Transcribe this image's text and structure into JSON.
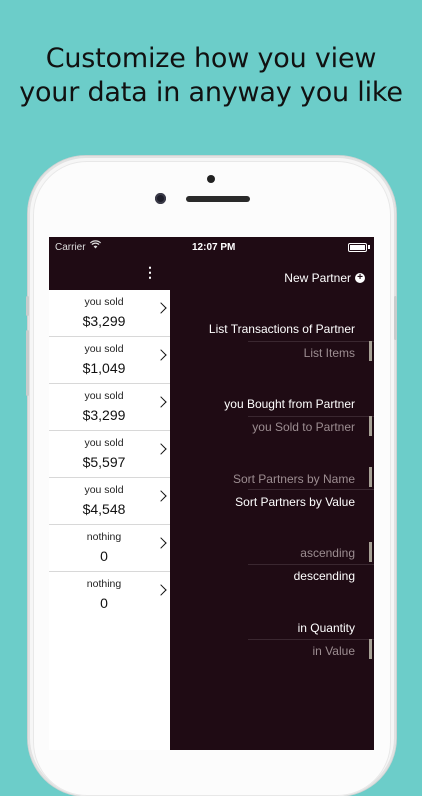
{
  "headline": {
    "line1": "Customize how you view",
    "line2": "your data in anyway you like"
  },
  "status_bar": {
    "carrier": "Carrier",
    "time": "12:07 PM"
  },
  "partners": [
    {
      "label": "you sold",
      "value": "$3,299"
    },
    {
      "label": "you sold",
      "value": "$1,049"
    },
    {
      "label": "you sold",
      "value": "$3,299"
    },
    {
      "label": "you sold",
      "value": "$5,597"
    },
    {
      "label": "you sold",
      "value": "$4,548"
    },
    {
      "label": "nothing",
      "value": "0"
    },
    {
      "label": "nothing",
      "value": "0"
    }
  ],
  "menu": {
    "new_partner": "New Partner",
    "list_transactions": "List Transactions of Partner",
    "list_items": "List Items",
    "you_bought": "you Bought from Partner",
    "you_sold": "you Sold to Partner",
    "sort_by_name": "Sort Partners by Name",
    "sort_by_value": "Sort Partners by Value",
    "ascending": "ascending",
    "descending": "descending",
    "in_quantity": "in Quantity",
    "in_value": "in Value"
  }
}
